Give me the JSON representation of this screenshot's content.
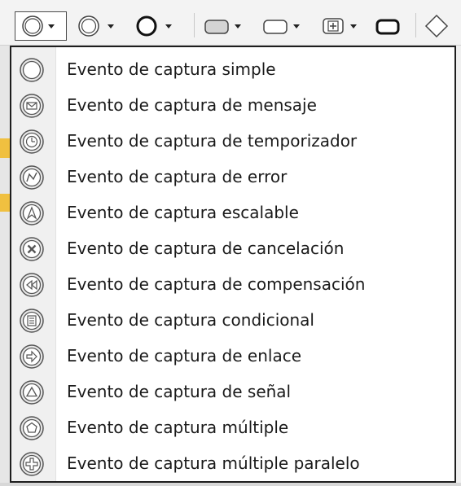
{
  "toolbar": {
    "buttons": [
      {
        "name": "start-event-button",
        "icon": "event-circle-icon"
      },
      {
        "name": "intermediate-event-button",
        "icon": "double-circle-icon"
      },
      {
        "name": "end-event-button",
        "icon": "thick-circle-icon"
      },
      {
        "name": "task-button",
        "icon": "filled-rounded-rect-icon"
      },
      {
        "name": "subprocess-button",
        "icon": "rounded-rect-icon"
      },
      {
        "name": "collapsed-subprocess-button",
        "icon": "plus-square-icon"
      },
      {
        "name": "transaction-button",
        "icon": "bold-rounded-rect-icon"
      },
      {
        "name": "gateway-button",
        "icon": "diamond-icon"
      }
    ]
  },
  "menu": {
    "items": [
      {
        "label": "Evento de captura simple",
        "icon": "catch-plain-icon"
      },
      {
        "label": "Evento de captura de mensaje",
        "icon": "catch-message-icon"
      },
      {
        "label": "Evento de captura de temporizador",
        "icon": "catch-timer-icon"
      },
      {
        "label": "Evento de captura de error",
        "icon": "catch-error-icon"
      },
      {
        "label": "Evento de captura escalable",
        "icon": "catch-escalation-icon"
      },
      {
        "label": "Evento de captura de cancelación",
        "icon": "catch-cancel-icon"
      },
      {
        "label": "Evento de captura de compensación",
        "icon": "catch-compensation-icon"
      },
      {
        "label": "Evento de captura condicional",
        "icon": "catch-conditional-icon"
      },
      {
        "label": "Evento de captura de enlace",
        "icon": "catch-link-icon"
      },
      {
        "label": "Evento de captura de señal",
        "icon": "catch-signal-icon"
      },
      {
        "label": "Evento de captura múltiple",
        "icon": "catch-multiple-icon"
      },
      {
        "label": "Evento de captura múltiple paralelo",
        "icon": "catch-parallel-multiple-icon"
      }
    ]
  },
  "colors": {
    "menu_border": "#1e1e1e",
    "gutter": "#f0f0f0",
    "icon_stroke": "#555555",
    "icon_fill": "#e8e8e8"
  }
}
